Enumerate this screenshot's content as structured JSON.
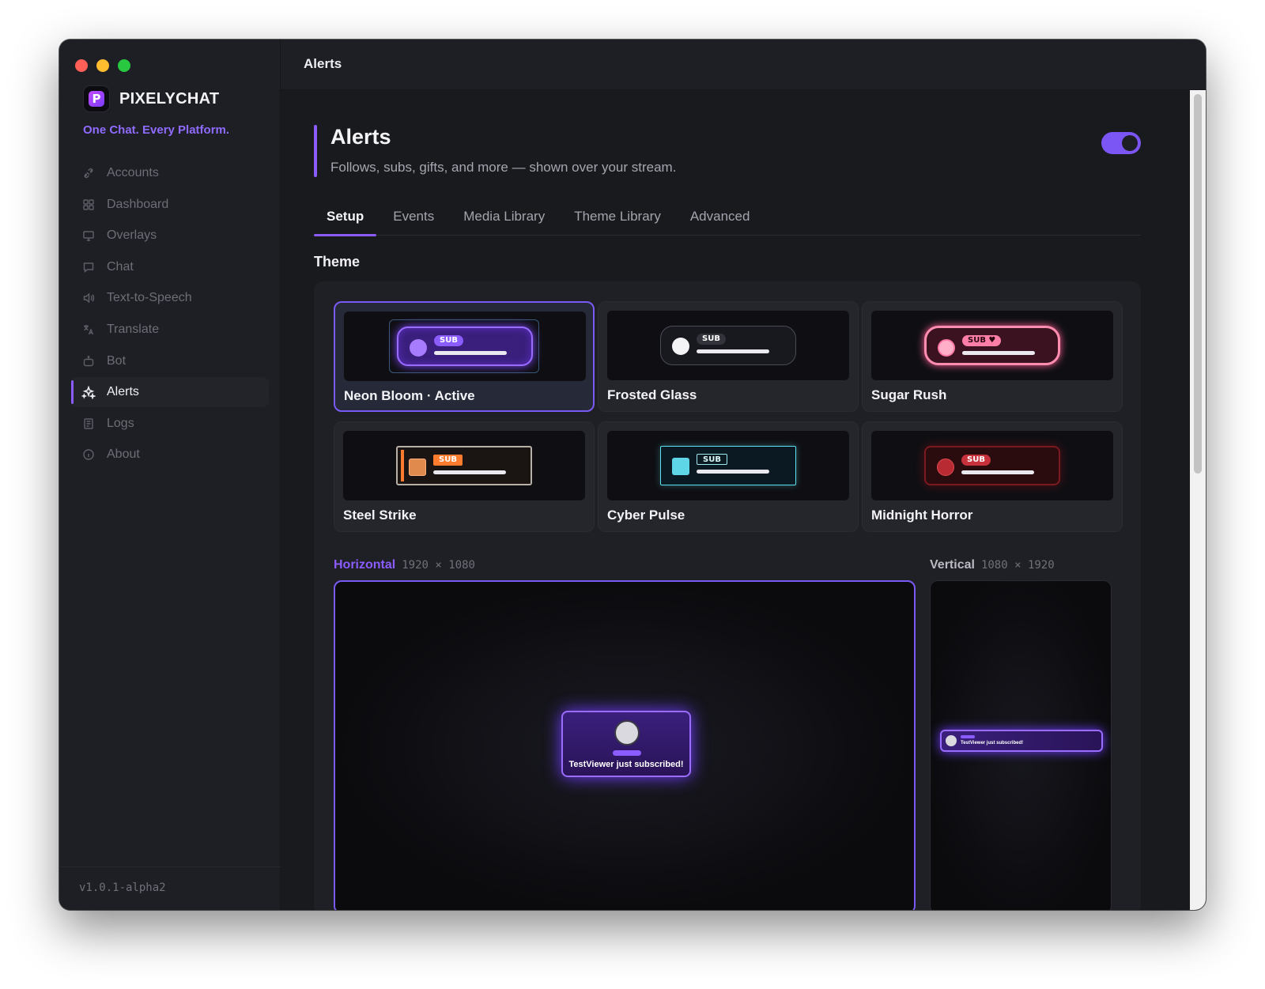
{
  "titlebar": {
    "title": "Alerts"
  },
  "brand": {
    "name": "PIXELYCHAT",
    "logo_letter": "P",
    "tagline": "One Chat. Every Platform.",
    "accent": "#8f6bff"
  },
  "sidebar": {
    "items": [
      {
        "label": "Accounts",
        "icon": "plug-icon"
      },
      {
        "label": "Dashboard",
        "icon": "grid-icon"
      },
      {
        "label": "Overlays",
        "icon": "monitor-icon"
      },
      {
        "label": "Chat",
        "icon": "chat-bubble-icon"
      },
      {
        "label": "Text-to-Speech",
        "icon": "speaker-icon"
      },
      {
        "label": "Translate",
        "icon": "translate-icon"
      },
      {
        "label": "Bot",
        "icon": "robot-icon"
      },
      {
        "label": "Alerts",
        "icon": "sparkle-icon",
        "active": true
      },
      {
        "label": "Logs",
        "icon": "logs-icon"
      },
      {
        "label": "About",
        "icon": "info-icon"
      }
    ],
    "version": "v1.0.1-alpha2"
  },
  "header": {
    "title": "Alerts",
    "subtitle": "Follows, subs, gifts, and more — shown over your stream.",
    "enabled": true
  },
  "tabs": [
    {
      "label": "Setup",
      "active": true
    },
    {
      "label": "Events"
    },
    {
      "label": "Media Library"
    },
    {
      "label": "Theme Library"
    },
    {
      "label": "Advanced"
    }
  ],
  "theme_section": {
    "label": "Theme",
    "themes": [
      {
        "name": "Neon Bloom · Active",
        "tag": "SUB",
        "active": true
      },
      {
        "name": "Frosted Glass",
        "tag": "SUB"
      },
      {
        "name": "Sugar Rush",
        "tag": "SUB ♥"
      },
      {
        "name": "Steel Strike",
        "tag": "SUB"
      },
      {
        "name": "Cyber Pulse",
        "tag": "SUB"
      },
      {
        "name": "Midnight Horror",
        "tag": "SUB"
      }
    ]
  },
  "preview": {
    "horizontal": {
      "label": "Horizontal",
      "dims": "1920 × 1080",
      "color": "#8b5cff"
    },
    "vertical": {
      "label": "Vertical",
      "dims": "1080 × 1920"
    },
    "alert_message": "TestViewer just subscribed!"
  }
}
